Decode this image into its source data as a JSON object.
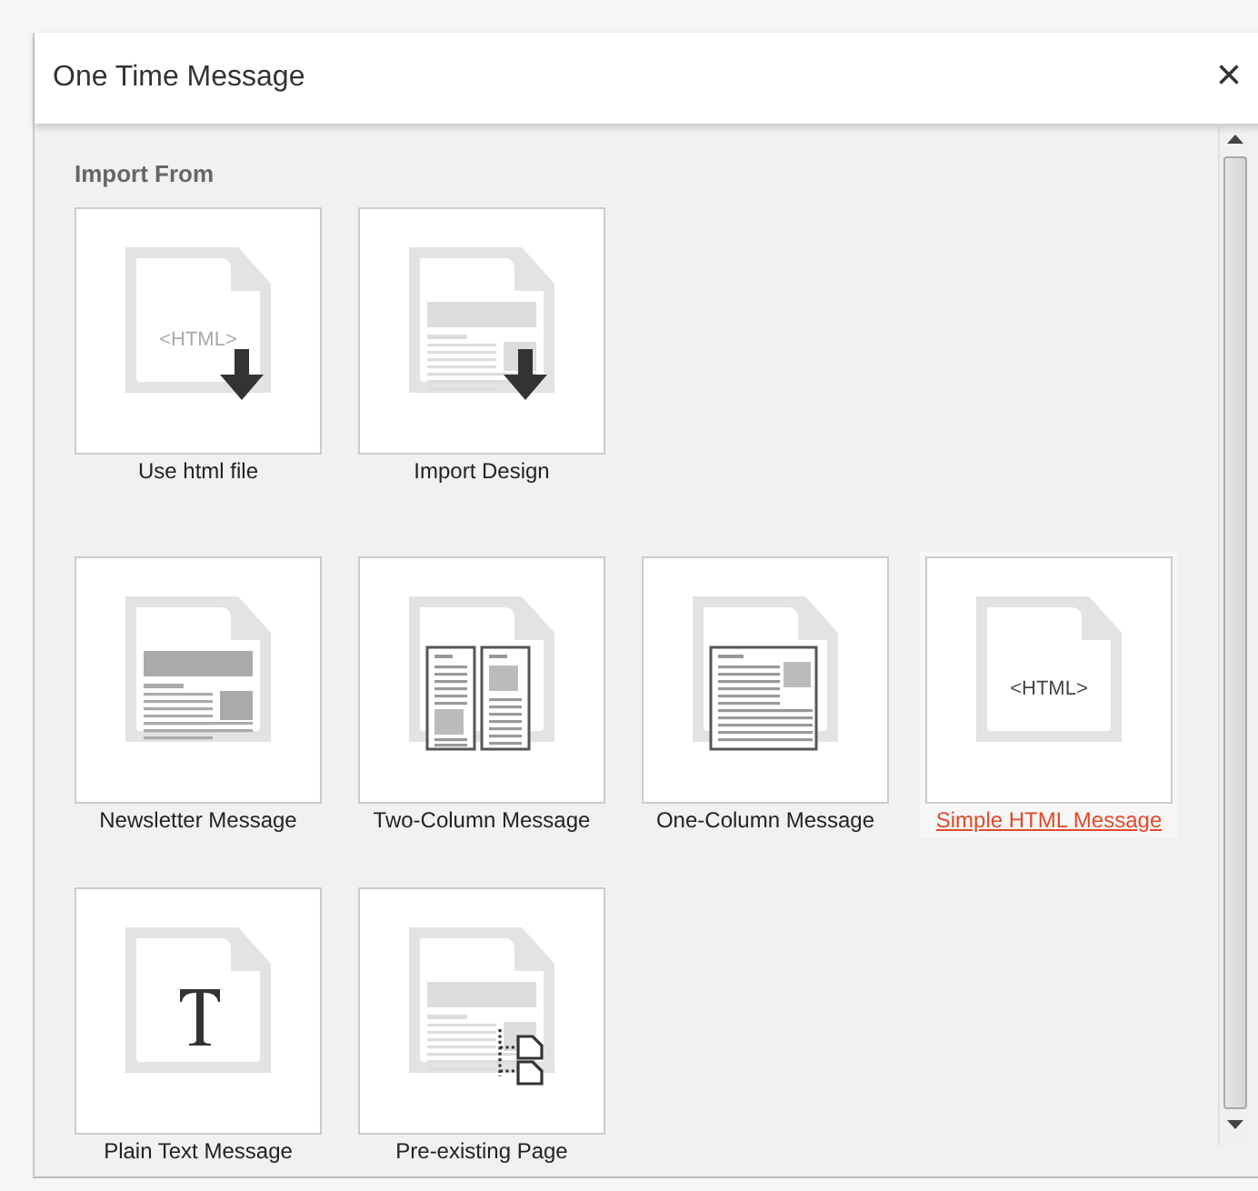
{
  "dialog": {
    "title": "One Time Message",
    "close": "×"
  },
  "sections": [
    {
      "heading": "Import From",
      "items": [
        {
          "label": "Use html file",
          "kind": "html-download",
          "icon_text": "<HTML>",
          "selected": false
        },
        {
          "label": "Import Design",
          "kind": "design-download",
          "selected": false
        }
      ]
    },
    {
      "items": [
        {
          "label": "Newsletter Message",
          "kind": "newsletter",
          "selected": false
        },
        {
          "label": "Two-Column Message",
          "kind": "two-column",
          "selected": false
        },
        {
          "label": "One-Column Message",
          "kind": "one-column",
          "selected": false
        },
        {
          "label": "Simple HTML Message",
          "kind": "html",
          "icon_text": "<HTML>",
          "selected": true
        },
        {
          "label": "Plain Text Message",
          "kind": "text",
          "selected": false
        },
        {
          "label": "Pre-existing Page",
          "kind": "pre-existing",
          "selected": false
        }
      ]
    }
  ]
}
